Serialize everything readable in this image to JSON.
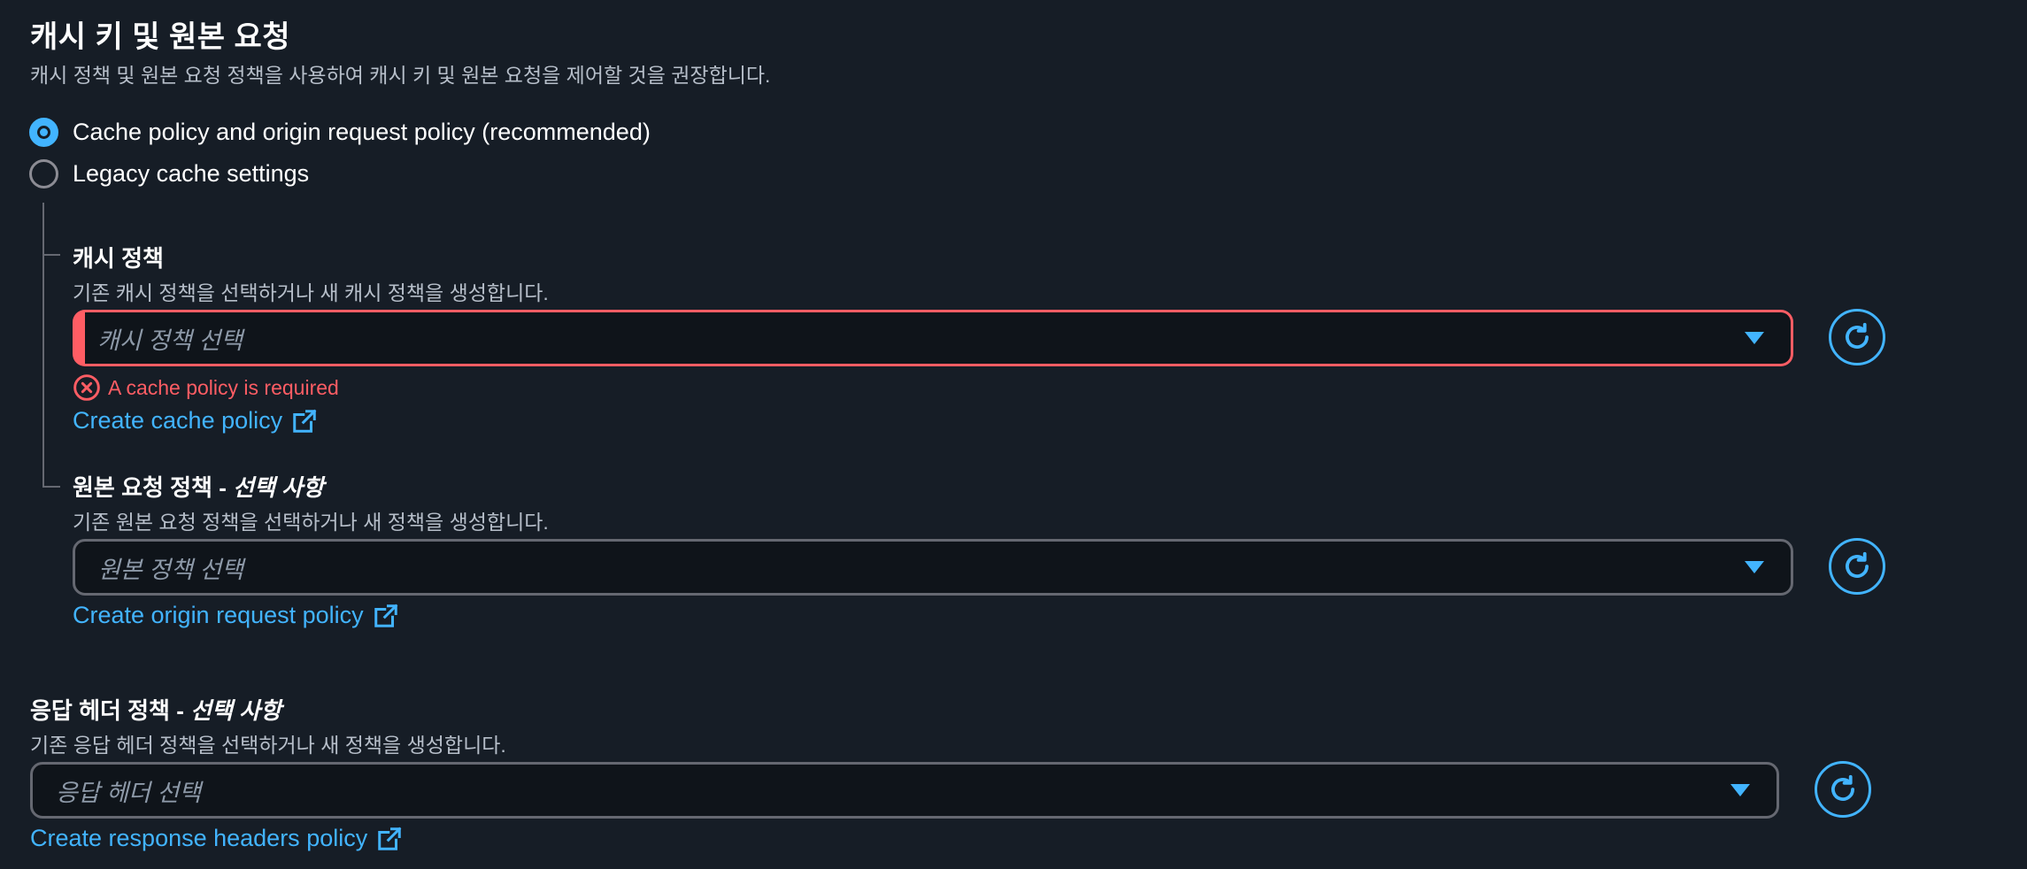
{
  "section": {
    "title": "캐시 키 및 원본 요청",
    "description": "캐시 정책 및 원본 요청 정책을 사용하여 캐시 키 및 원본 요청을 제어할 것을 권장합니다."
  },
  "radios": [
    {
      "label": "Cache policy and origin request policy (recommended)",
      "checked": true
    },
    {
      "label": "Legacy cache settings",
      "checked": false
    }
  ],
  "cache_policy": {
    "title": "캐시 정책",
    "description": "기존 캐시 정책을 선택하거나 새 캐시 정책을 생성합니다.",
    "placeholder": "캐시 정책 선택",
    "error": "A cache policy is required",
    "link": "Create cache policy"
  },
  "origin_policy": {
    "title": "원본 요청 정책 - ",
    "title_optional": "선택 사항",
    "description": "기존 원본 요청 정책을 선택하거나 새 정책을 생성합니다.",
    "placeholder": "원본 정책 선택",
    "link": "Create origin request policy"
  },
  "response_policy": {
    "title": "응답 헤더 정책 - ",
    "title_optional": "선택 사항",
    "description": "기존 응답 헤더 정책을 선택하거나 새 정책을 생성합니다.",
    "placeholder": "응답 헤더 선택",
    "link": "Create response headers policy"
  },
  "colors": {
    "background": "#161d26",
    "accent": "#42b4ff",
    "error": "#ff5d64",
    "border": "#656871"
  },
  "icons": {
    "refresh": "refresh-icon",
    "external": "external-link-icon",
    "error": "error-icon",
    "caret": "caret-down-icon"
  }
}
